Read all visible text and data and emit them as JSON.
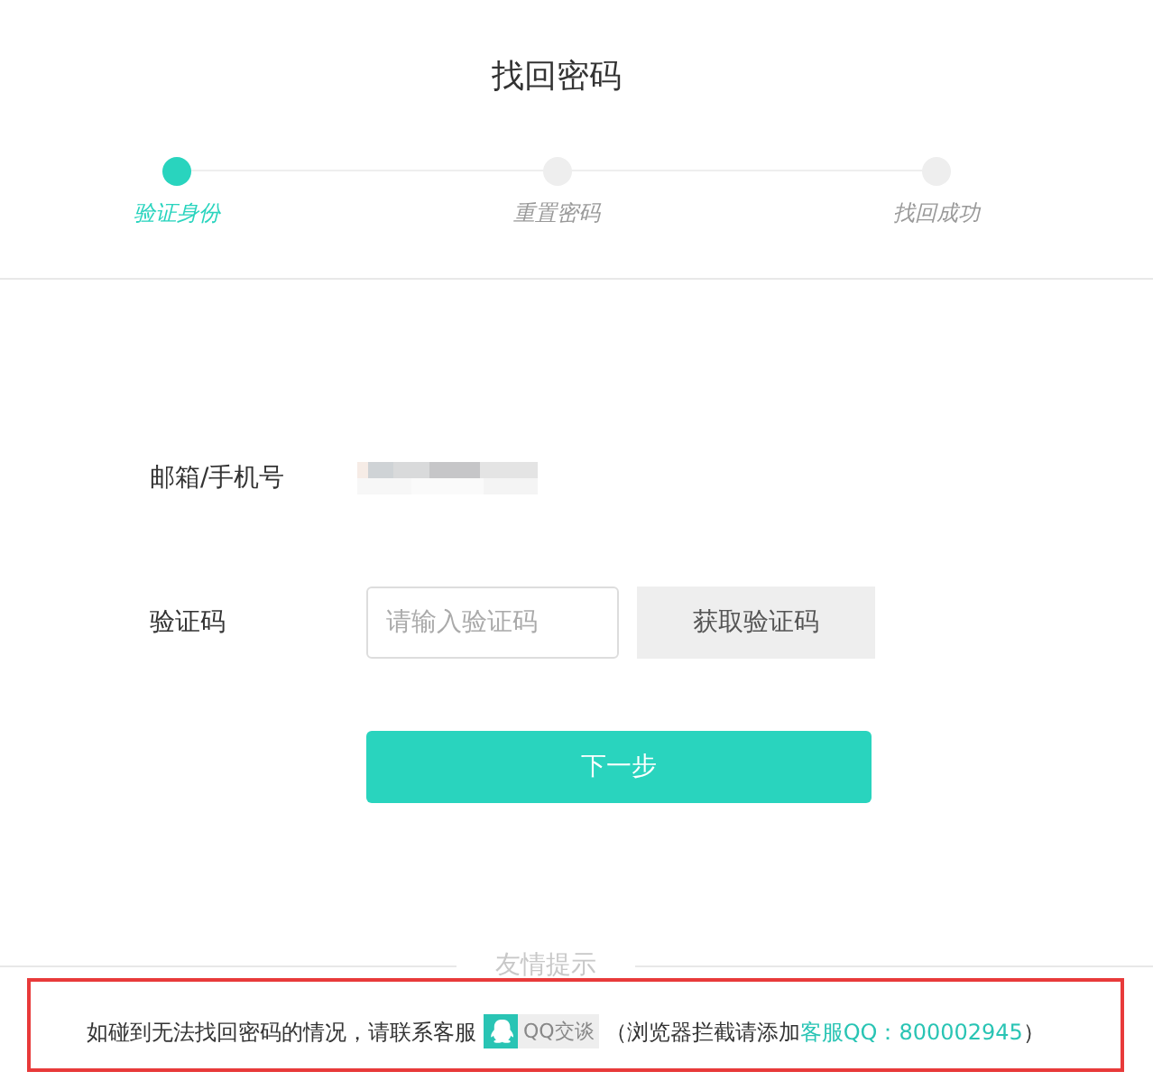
{
  "title": "找回密码",
  "steps": [
    {
      "label": "验证身份",
      "selected": true
    },
    {
      "label": "重置密码",
      "selected": false
    },
    {
      "label": "找回成功",
      "selected": false
    }
  ],
  "form": {
    "fields": [
      {
        "kind": "blurred",
        "label": "邮箱/手机号"
      },
      {
        "kind": "code",
        "label": "验证码",
        "placeholder": "请输入验证码",
        "button": "获取验证码"
      }
    ],
    "submit": "下一步"
  },
  "notice": {
    "heading": "友情提示",
    "highlighted": true,
    "text": "如碰到无法找回密码的情况，请联系客服",
    "qq_button": "QQ交谈",
    "note_before": "（浏览器拦截请添加",
    "link": "客服QQ：800002945",
    "note_after": "）"
  }
}
